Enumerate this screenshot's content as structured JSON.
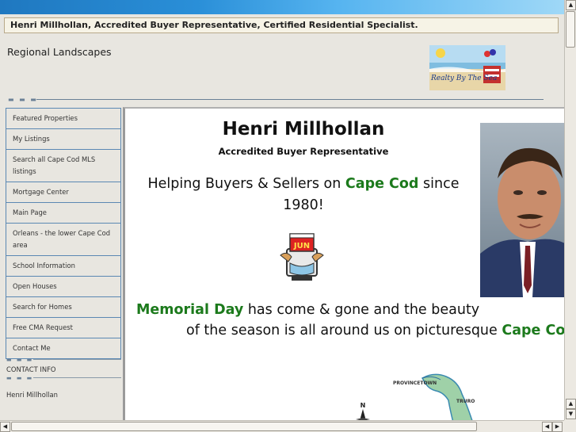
{
  "header": {
    "title": "Henri Millhollan, Accredited Buyer Representative, Certified Residential Specialist.",
    "site_name": "Regional Landscapes",
    "logo_text": "Realty By The Sea"
  },
  "nav": {
    "items": [
      {
        "label": "Featured Properties"
      },
      {
        "label": "My Listings"
      },
      {
        "label": "Search all Cape Cod MLS listings"
      },
      {
        "label": "Mortgage Center"
      },
      {
        "label": "Main Page"
      },
      {
        "label": "Orleans - the lower Cape Cod area"
      },
      {
        "label": "School Information"
      },
      {
        "label": "Open Houses"
      },
      {
        "label": "Search for Homes"
      },
      {
        "label": "Free CMA Request"
      },
      {
        "label": "Contact Me"
      }
    ]
  },
  "contact": {
    "label": "CONTACT INFO",
    "name": "Henri Millhollan"
  },
  "main": {
    "name": "Henri Millhollan",
    "subtitle": "Accredited Buyer Representative",
    "help_prefix": "Helping Buyers & Sellers on ",
    "help_highlight": "Cape Cod",
    "help_suffix": " since 1980!",
    "calendar_month": "JUN",
    "memorial_highlight": "Memorial Day",
    "memorial_rest": " has come & gone and the beauty",
    "season_prefix": "of the season is all around us on picturesque ",
    "season_highlight": "Cape Cod",
    "map_label_1": "PROVINCETOWN",
    "map_label_2": "TRURO",
    "compass_letter": "N"
  },
  "colors": {
    "highlight_green": "#1c7a1c",
    "nav_border": "#5b88b3",
    "page_bg": "#e8e6e0"
  }
}
